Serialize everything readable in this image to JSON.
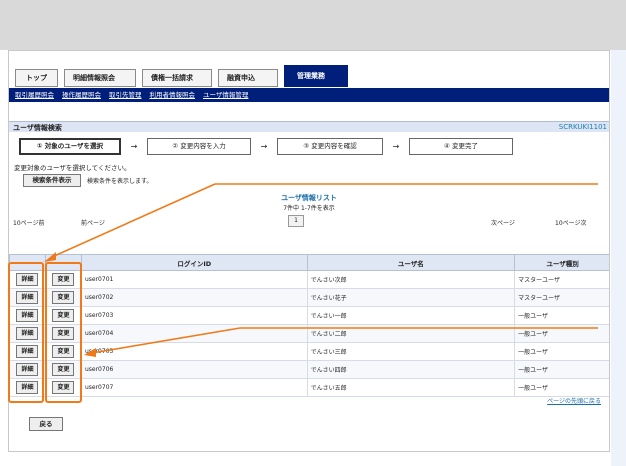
{
  "tabs": [
    "トップ",
    "明細情報照会",
    "債権一括請求",
    "融資申込",
    "管理業務"
  ],
  "subnav": [
    "取引履歴照会",
    "操作履歴照会",
    "取引先管理",
    "利用者情報照会",
    "ユーザ情報管理"
  ],
  "title": "ユーザ情報検索",
  "screen_id": "SCRKUKI1101",
  "steps": [
    "① 対象のユーザを選択",
    "② 変更内容を入力",
    "③ 変更内容を確認",
    "④ 変更完了"
  ],
  "instruction": "変更対象のユーザを選択してください。",
  "cond_button": "検索条件表示",
  "cond_text": "検索条件を表示します。",
  "list_title": "ユーザ情報リスト",
  "list_count": "7件中 1-7件を表示",
  "pager": {
    "prev10": "10ページ前",
    "prev": "前ページ",
    "current": "1",
    "next": "次ページ",
    "next10": "10ページ次"
  },
  "table": {
    "headers": [
      "",
      "",
      "ログインID",
      "ユーザ名",
      "ユーザ種別"
    ],
    "detail_label": "詳細",
    "change_label": "変更",
    "rows": [
      {
        "id": "user0701",
        "name": "でんさい次郎",
        "type": "マスターユーザ"
      },
      {
        "id": "user0702",
        "name": "でんさい花子",
        "type": "マスターユーザ"
      },
      {
        "id": "user0703",
        "name": "でんさい一郎",
        "type": "一般ユーザ"
      },
      {
        "id": "user0704",
        "name": "でんさい二郎",
        "type": "一般ユーザ"
      },
      {
        "id": "user0705",
        "name": "でんさい三郎",
        "type": "一般ユーザ"
      },
      {
        "id": "user0706",
        "name": "でんさい四郎",
        "type": "一般ユーザ"
      },
      {
        "id": "user0707",
        "name": "でんさい五郎",
        "type": "一般ユーザ"
      }
    ]
  },
  "page_top_link": "ページの先頭に戻る",
  "back_button": "戻る",
  "colors": {
    "nav": "#001f7a",
    "annotation": "#f07a1a",
    "header_bg": "#dfe6f4"
  }
}
